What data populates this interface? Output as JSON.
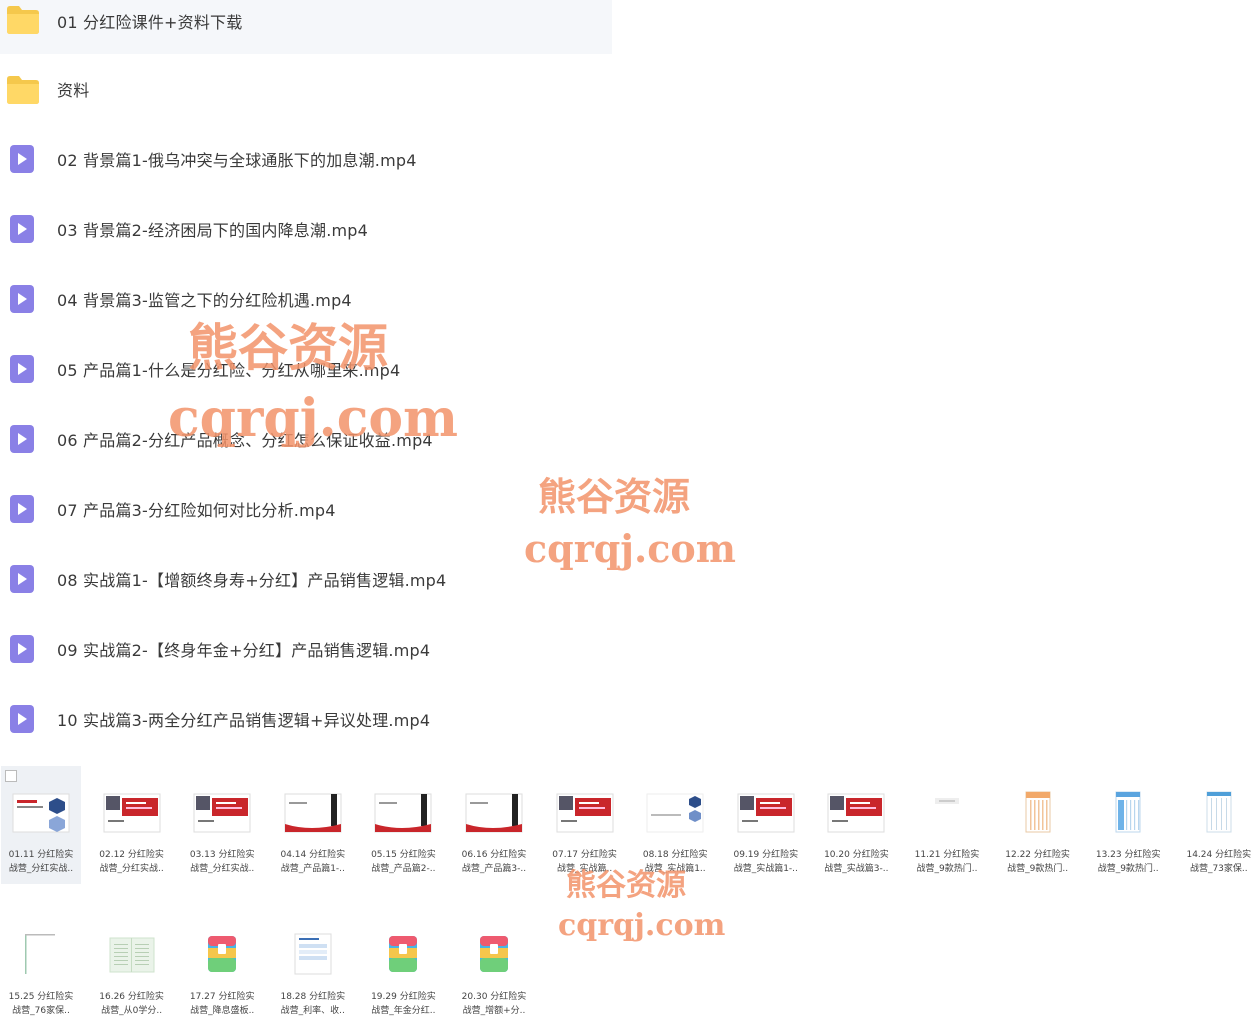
{
  "list": [
    {
      "type": "folder",
      "name": "01 分红险课件+资料下载",
      "selected": true
    },
    {
      "type": "folder",
      "name": "资料"
    },
    {
      "type": "video",
      "name": "02 背景篇1-俄乌冲突与全球通胀下的加息潮.mp4"
    },
    {
      "type": "video",
      "name": "03 背景篇2-经济困局下的国内降息潮.mp4"
    },
    {
      "type": "video",
      "name": "04 背景篇3-监管之下的分红险机遇.mp4"
    },
    {
      "type": "video",
      "name": "05 产品篇1-什么是分红险、分红从哪里来.mp4"
    },
    {
      "type": "video",
      "name": "06 产品篇2-分红产品概念、分红怎么保证收益.mp4"
    },
    {
      "type": "video",
      "name": "07 产品篇3-分红险如何对比分析.mp4"
    },
    {
      "type": "video",
      "name": "08 实战篇1-【增额终身寿+分红】产品销售逻辑.mp4"
    },
    {
      "type": "video",
      "name": "09 实战篇2-【终身年金+分红】产品销售逻辑.mp4"
    },
    {
      "type": "video",
      "name": "10 实战篇3-两全分红产品销售逻辑+异议处理.mp4"
    }
  ],
  "thumbs": [
    {
      "l1": "01.11 分红险实",
      "l2": "战营_分红实战..",
      "kind": "slide"
    },
    {
      "l1": "02.12 分红险实",
      "l2": "战营_分红实战..",
      "kind": "slide-red"
    },
    {
      "l1": "03.13 分红险实",
      "l2": "战营_分红实战..",
      "kind": "slide-red"
    },
    {
      "l1": "04.14 分红险实",
      "l2": "战营_产品篇1-..",
      "kind": "slide-bar"
    },
    {
      "l1": "05.15 分红险实",
      "l2": "战营_产品篇2-..",
      "kind": "slide-bar"
    },
    {
      "l1": "06.16 分红险实",
      "l2": "战营_产品篇3-..",
      "kind": "slide-bar"
    },
    {
      "l1": "07.17 分红险实",
      "l2": "战营_实战篇..",
      "kind": "slide-red"
    },
    {
      "l1": "08.18 分红险实",
      "l2": "战营_实战篇1..",
      "kind": "slide-hex"
    },
    {
      "l1": "09.19 分红险实",
      "l2": "战营_实战篇1-..",
      "kind": "slide-red"
    },
    {
      "l1": "10.20 分红险实",
      "l2": "战营_实战篇3-..",
      "kind": "slide-red"
    },
    {
      "l1": "11.21 分红险实",
      "l2": "战营_9款热门..",
      "kind": "blank"
    },
    {
      "l1": "12.22 分红险实",
      "l2": "战营_9款热门..",
      "kind": "sheet-orange"
    },
    {
      "l1": "13.23 分红险实",
      "l2": "战营_9款热门..",
      "kind": "sheet-blue"
    },
    {
      "l1": "14.24 分红险实",
      "l2": "战营_73家保..",
      "kind": "sheet-light"
    },
    {
      "l1": "15.25 分红险实",
      "l2": "战营_76家保..",
      "kind": "doc-line"
    },
    {
      "l1": "16.26 分红险实",
      "l2": "战营_从0学分..",
      "kind": "doc-green"
    },
    {
      "l1": "17.27 分红险实",
      "l2": "战营_降息盛板..",
      "kind": "archive"
    },
    {
      "l1": "18.28 分红险实",
      "l2": "战营_利率、收..",
      "kind": "doc-blue"
    },
    {
      "l1": "19.29 分红险实",
      "l2": "战营_年金分红..",
      "kind": "archive"
    },
    {
      "l1": "20.30 分红险实",
      "l2": "战营_增额+分..",
      "kind": "archive"
    }
  ],
  "watermark": {
    "cn": "熊谷资源",
    "url": "cqrqj.com",
    "color": "#f3936a"
  },
  "colors": {
    "folder": "#f5c84c",
    "video": "#8a80e6",
    "accent_red": "#c9262b"
  }
}
